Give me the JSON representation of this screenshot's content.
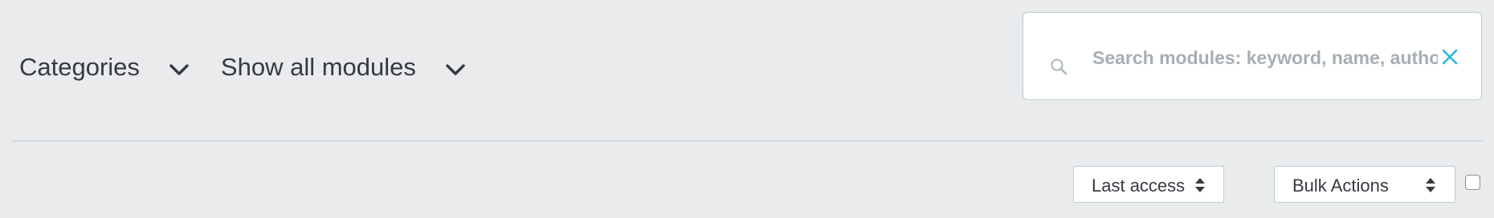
{
  "filters": {
    "categories_label": "Categories",
    "modules_label": "Show all modules"
  },
  "search": {
    "placeholder": "Search modules: keyword, name, author...",
    "value": ""
  },
  "sort": {
    "selected": "Last access"
  },
  "bulk": {
    "selected": "Bulk Actions"
  },
  "icons": {
    "chevron": "chevron-down-icon",
    "search": "search-icon",
    "clear": "close-icon",
    "sort": "sort-updown-icon"
  },
  "colors": {
    "background": "#eaebed",
    "text": "#363a41",
    "accent": "#25b9d7",
    "border": "#bbcdd2",
    "placeholder": "#a7afb4"
  }
}
